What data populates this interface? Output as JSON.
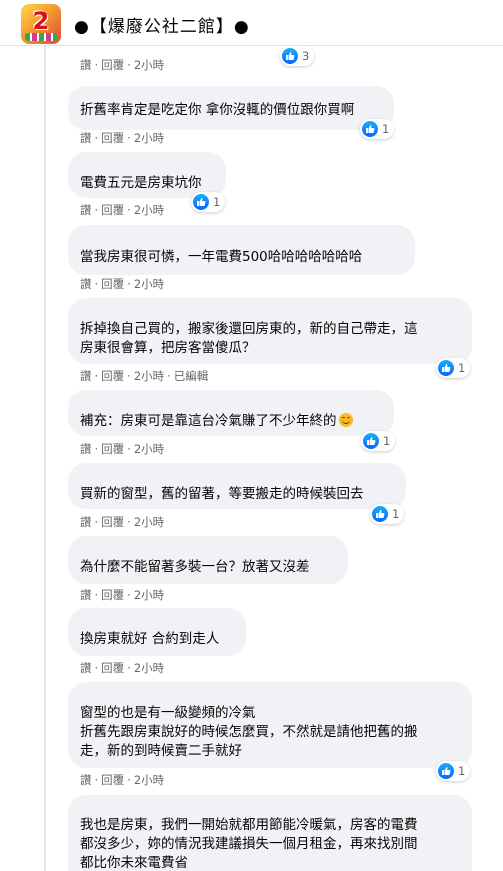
{
  "header": {
    "group_name": "●【爆廢公社二館】●",
    "avatar_text": "2"
  },
  "colors": {
    "bubble_bg": "#f0f2f5",
    "like_blue": "#0866ff",
    "meta_gray": "#65676b"
  },
  "comments": [
    {
      "text": "",
      "actions": {
        "like": "讚",
        "reply": "回覆",
        "time": "2小時"
      },
      "reactions": "3"
    },
    {
      "text": "折舊率肯定是吃定你 拿你沒輒的價位跟你買啊",
      "actions": {
        "like": "讚",
        "reply": "回覆",
        "time": "2小時"
      },
      "reactions": "1"
    },
    {
      "text": "電費五元是房東坑你",
      "actions": {
        "like": "讚",
        "reply": "回覆",
        "time": "2小時"
      },
      "reactions": "1"
    },
    {
      "text": "當我房東很可憐，一年電費500哈哈哈哈哈哈哈",
      "actions": {
        "like": "讚",
        "reply": "回覆",
        "time": "2小時"
      },
      "reactions": ""
    },
    {
      "text": "拆掉換自己買的，搬家後還回房東的，新的自己帶走，這\n房東很會算，把房客當傻瓜？",
      "actions": {
        "like": "讚",
        "reply": "回覆",
        "time": "2小時",
        "edited": "已編輯"
      },
      "reactions": "1"
    },
    {
      "text": "補充：房東可是靠這台冷氣賺了不少年終的",
      "actions": {
        "like": "讚",
        "reply": "回覆",
        "time": "2小時"
      },
      "reactions": "1"
    },
    {
      "text": "買新的窗型，舊的留著，等要搬走的時候裝回去",
      "actions": {
        "like": "讚",
        "reply": "回覆",
        "time": "2小時"
      },
      "reactions": "1"
    },
    {
      "text": "為什麼不能留著多裝一台？放著又沒差",
      "actions": {
        "like": "讚",
        "reply": "回覆",
        "time": "2小時"
      },
      "reactions": ""
    },
    {
      "text": "換房東就好 合約到走人",
      "actions": {
        "like": "讚",
        "reply": "回覆",
        "time": "2小時"
      },
      "reactions": ""
    },
    {
      "text": "窗型的也是有一級變頻的冷氣\n折舊先跟房東說好的時候怎麼買，不然就是請他把舊的搬\n走，新的到時候賣二手就好",
      "actions": {
        "like": "讚",
        "reply": "回覆",
        "time": "2小時"
      },
      "reactions": "1"
    },
    {
      "text": "我也是房東，我們一開始就都用節能冷暖氣，房客的電費\n都沒多少，妳的情況我建議損失一個月租金，再來找別間\n都比你未來電費省",
      "actions": {},
      "reactions": ""
    }
  ]
}
